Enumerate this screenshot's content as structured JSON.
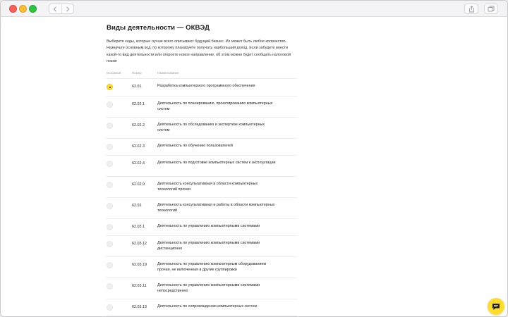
{
  "page": {
    "title": "Виды деятельности — ОКВЭД",
    "description": "Выберите коды, которые лучше всего описывают будущий бизнес. Их может быть любое количество. Назначьте основным код, по которому планируете получать наибольший доход. Если забудете внести какой-то вид деятельности или откроете новое направление, об этом можно будет сообщить налоговой позже"
  },
  "table": {
    "headers": {
      "main": "Основной",
      "code": "Номер",
      "name": "Наименование"
    },
    "rows": [
      {
        "code": "62.01",
        "name": "Разработка компьютерного программного обеспечения",
        "selected": true
      },
      {
        "code": "62.02.1",
        "name": "Деятельность по планированию, проектированию компьютерных систем",
        "selected": false
      },
      {
        "code": "62.02.2",
        "name": "Деятельность по обследованию и экспертизе компьютерных систем",
        "selected": false
      },
      {
        "code": "62.02.3",
        "name": "Деятельность по обучению пользователей",
        "selected": false
      },
      {
        "code": "62.02.4",
        "name": "Деятельность по подготовке компьютерных систем к эксплуатации",
        "selected": false
      },
      {
        "code": "62.02.9",
        "name": "Деятельность консультативная в области компьютерных технологий прочая",
        "selected": false
      },
      {
        "code": "62.02",
        "name": "Деятельность консультативная и работы в области компьютерных технологий",
        "selected": false
      },
      {
        "code": "62.03.1",
        "name": "Деятельность по управлению компьютерными системами",
        "selected": false
      },
      {
        "code": "62.03.12",
        "name": "Деятельность по управлению компьютерными системами дистанционно",
        "selected": false
      },
      {
        "code": "62.03.19",
        "name": "Деятельность по управлению компьютерным оборудованием прочая, не включенная в другие группировки",
        "selected": false
      },
      {
        "code": "62.03.11",
        "name": "Деятельность по управлению компьютерными системами непосредственно",
        "selected": false
      },
      {
        "code": "62.03.13",
        "name": "Деятельность по сопровождению компьютерных систем",
        "selected": false
      }
    ]
  },
  "icons": {
    "back": "chevron-left-icon",
    "forward": "chevron-right-icon",
    "share": "share-icon",
    "tabs": "tabs-icon",
    "chat": "chat-icon"
  },
  "colors": {
    "accent": "#ffdd2d",
    "radio_empty": "#f0f0f2"
  }
}
